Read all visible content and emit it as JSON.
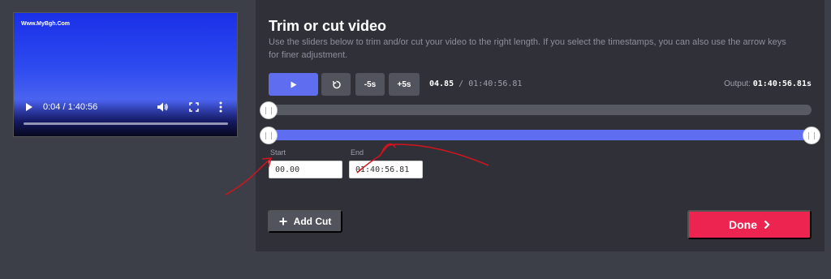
{
  "video": {
    "watermark": "Www.MyBgh.Com",
    "time": "0:04 / 1:40:56",
    "progress_fraction": 0.001
  },
  "panel": {
    "title": "Trim or cut video",
    "description": "Use the sliders below to trim and/or cut your video to the right length. If you select the timestamps, you can also use the arrow keys for finer adjustment."
  },
  "controls": {
    "minus_label": "-5s",
    "plus_label": "+5s",
    "current_time": "04.85",
    "separator": "/",
    "total_time": "01:40:56.81",
    "output_label": "Output:",
    "output_value": "01:40:56.81s"
  },
  "fields": {
    "start_label": "Start",
    "start_value": "00.00",
    "end_label": "End",
    "end_value": "01:40:56.81"
  },
  "actions": {
    "add_cut_label": "Add Cut",
    "done_label": "Done"
  },
  "colors": {
    "accent": "#5f6ef0",
    "done": "#ee2450",
    "annotation": "#d4141c"
  },
  "icons": {
    "play": "play-icon",
    "reset": "rotate-icon",
    "add": "plus-icon",
    "done": "chevron-right-icon"
  }
}
